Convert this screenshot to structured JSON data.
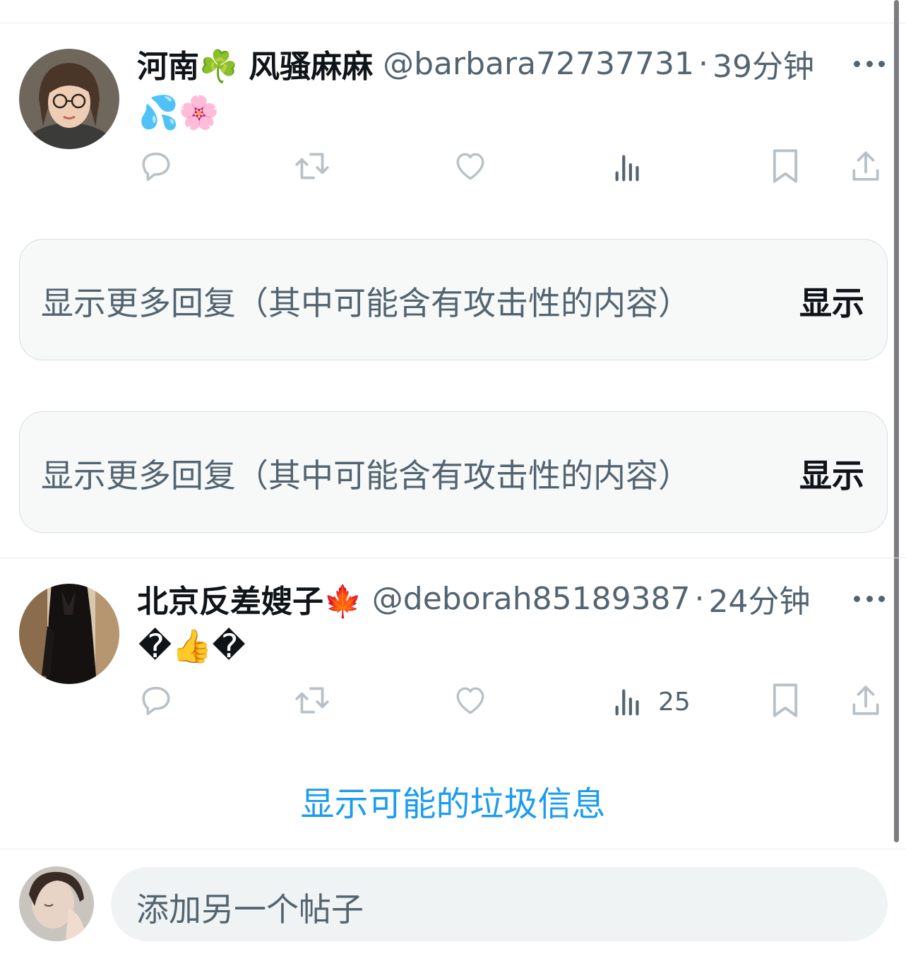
{
  "tweets": [
    {
      "author": "河南☘️ 风骚麻麻",
      "handle": "@barbara72737731",
      "separator": "·",
      "time": "39分钟",
      "text": "💦🌸",
      "views": ""
    },
    {
      "author": "北京反差嫂子🍁",
      "handle": "@deborah85189387",
      "separator": "·",
      "time": "24分钟",
      "text": "�👍�",
      "views": "25"
    }
  ],
  "hidden_replies": [
    {
      "text": "显示更多回复（其中可能含有攻击性的内容）",
      "button": "显示"
    },
    {
      "text": "显示更多回复（其中可能含有攻击性的内容）",
      "button": "显示"
    }
  ],
  "spam_link": "显示可能的垃圾信息",
  "composer": {
    "placeholder": "添加另一个帖子"
  },
  "icons": {
    "reply": "reply-icon",
    "retweet": "retweet-icon",
    "like": "heart-icon",
    "views": "views-icon",
    "bookmark": "bookmark-icon",
    "share": "share-icon",
    "more": "more-icon"
  },
  "colors": {
    "link": "#1d9bf0",
    "secondary": "#536471",
    "icon": "#b8c0c8"
  }
}
